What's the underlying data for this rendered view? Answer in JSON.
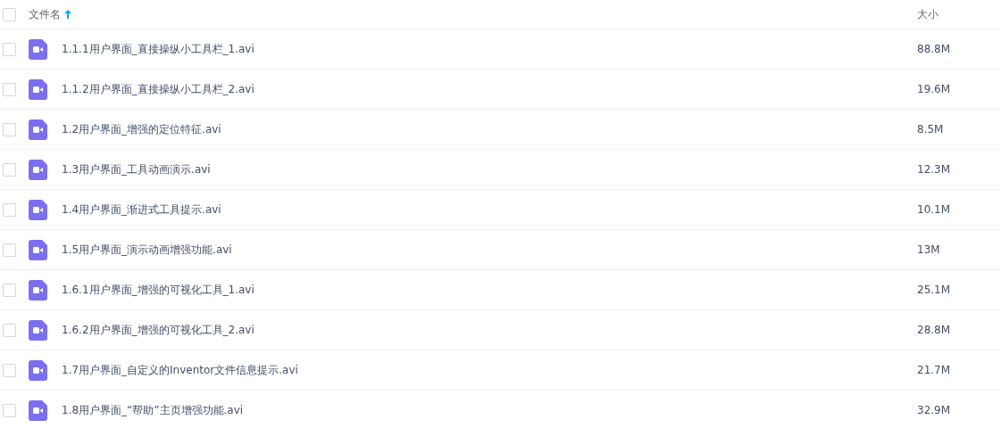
{
  "header": {
    "checked": false,
    "name_label": "文件名",
    "size_label": "大小"
  },
  "files": [
    {
      "name": "1.1.1用户界面_直接操纵小工具栏_1.avi",
      "size": "88.8M",
      "checked": false
    },
    {
      "name": "1.1.2用户界面_直接操纵小工具栏_2.avi",
      "size": "19.6M",
      "checked": false
    },
    {
      "name": "1.2用户界面_增强的定位特征.avi",
      "size": "8.5M",
      "checked": false
    },
    {
      "name": "1.3用户界面_工具动画演示.avi",
      "size": "12.3M",
      "checked": false
    },
    {
      "name": "1.4用户界面_渐进式工具提示.avi",
      "size": "10.1M",
      "checked": false
    },
    {
      "name": "1.5用户界面_演示动画增强功能.avi",
      "size": "13M",
      "checked": false
    },
    {
      "name": "1.6.1用户界面_增强的可视化工具_1.avi",
      "size": "25.1M",
      "checked": false
    },
    {
      "name": "1.6.2用户界面_增强的可视化工具_2.avi",
      "size": "28.8M",
      "checked": false
    },
    {
      "name": "1.7用户界面_自定义的Inventor文件信息提示.avi",
      "size": "21.7M",
      "checked": false
    },
    {
      "name": "1.8用户界面_“帮助”主页增强功能.avi",
      "size": "32.9M",
      "checked": false
    }
  ]
}
